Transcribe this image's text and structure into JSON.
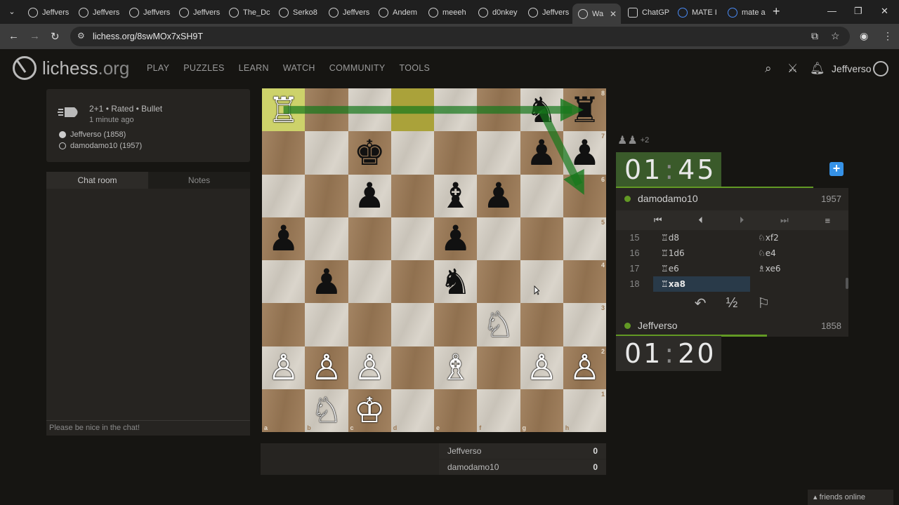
{
  "browser": {
    "tabs": [
      {
        "title": "Jeffvers",
        "icon": "lichess"
      },
      {
        "title": "Jeffvers",
        "icon": "lichess"
      },
      {
        "title": "Jeffvers",
        "icon": "lichess"
      },
      {
        "title": "Jeffvers",
        "icon": "lichess"
      },
      {
        "title": "The_Dc",
        "icon": "lichess"
      },
      {
        "title": "Serko8",
        "icon": "lichess"
      },
      {
        "title": "Jeffvers",
        "icon": "lichess"
      },
      {
        "title": "Andem",
        "icon": "lichess"
      },
      {
        "title": "meeeh",
        "icon": "lichess"
      },
      {
        "title": "d0nkey",
        "icon": "lichess"
      },
      {
        "title": "Jeffvers",
        "icon": "lichess"
      },
      {
        "title": "Wa",
        "icon": "lichess",
        "active": true
      },
      {
        "title": "ChatGP",
        "icon": "chatgpt"
      },
      {
        "title": "MATE I",
        "icon": "google"
      },
      {
        "title": "mate a",
        "icon": "google"
      }
    ],
    "url": "lichess.org/8swMOx7xSH9T"
  },
  "site": {
    "logo_name": "lichess",
    "logo_tld": ".org",
    "nav": [
      "PLAY",
      "PUZZLES",
      "LEARN",
      "WATCH",
      "COMMUNITY",
      "TOOLS"
    ],
    "username": "Jeffverso"
  },
  "game": {
    "type": "2+1 • Rated • Bullet",
    "when": "1 minute ago",
    "white": "Jeffverso (1858)",
    "black": "damodamo10 (1957)"
  },
  "chat": {
    "tabs": [
      "Chat room",
      "Notes"
    ],
    "placeholder": "Please be nice in the chat!"
  },
  "board": {
    "rows": [
      [
        "wR",
        "",
        "",
        "",
        "",
        "",
        "bN",
        "bR"
      ],
      [
        "",
        "",
        "bK",
        "",
        "",
        "",
        "bP",
        "bP"
      ],
      [
        "",
        "",
        "bP",
        "",
        "bB",
        "bP",
        "",
        ""
      ],
      [
        "bP",
        "",
        "",
        "",
        "bP",
        "",
        "",
        ""
      ],
      [
        "",
        "bP",
        "",
        "",
        "bN",
        "",
        "",
        ""
      ],
      [
        "",
        "",
        "",
        "",
        "",
        "wN",
        "",
        ""
      ],
      [
        "wP",
        "wP",
        "wP",
        "",
        "wB",
        "",
        "wP",
        "wP"
      ],
      [
        "",
        "wN",
        "wK",
        "",
        "",
        "",
        "",
        ""
      ]
    ],
    "highlights": [
      "a8",
      "d8"
    ],
    "ranks": [
      "8",
      "7",
      "6",
      "5",
      "4",
      "3",
      "2",
      "1"
    ],
    "files": [
      "a",
      "b",
      "c",
      "d",
      "e",
      "f",
      "g",
      "h"
    ],
    "arrows": [
      {
        "from": "a8",
        "to": "h8"
      },
      {
        "from": "g8",
        "to": "h6"
      }
    ]
  },
  "material": [
    {
      "name": "Jeffverso",
      "score": "0"
    },
    {
      "name": "damodamo10",
      "score": "0"
    }
  ],
  "spectators": "+2",
  "top": {
    "clock_min": "01",
    "clock_sec": "45",
    "name": "damodamo10",
    "rating": "1957",
    "time_fraction": 0.85
  },
  "bottom": {
    "clock_min": "01",
    "clock_sec": "20",
    "name": "Jeffverso",
    "rating": "1858",
    "time_fraction": 0.65
  },
  "moves": [
    {
      "n": "15",
      "w": "♖d8",
      "b": "♘xf2"
    },
    {
      "n": "16",
      "w": "♖1d6",
      "b": "♘e4"
    },
    {
      "n": "17",
      "w": "♖e6",
      "b": "♗xe6"
    },
    {
      "n": "18",
      "w": "♖xa8",
      "b": ""
    }
  ],
  "friends": "friends online",
  "colors": {
    "accent_green": "#629924",
    "highlight": "#cdd26a",
    "blue": "#3692e7"
  }
}
